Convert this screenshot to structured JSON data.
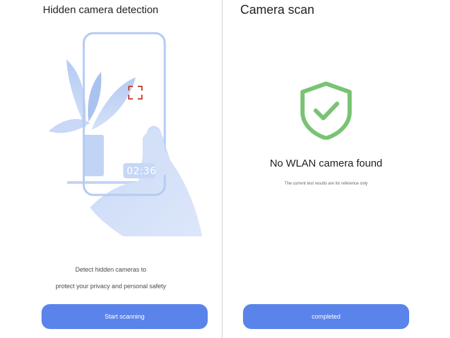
{
  "left_screen": {
    "title": "Hidden camera detection",
    "illustration": {
      "timer": "02:36"
    },
    "description_line1": "Detect hidden cameras to",
    "description_line2": "protect your privacy and personal safety",
    "start_button_label": "Start scanning"
  },
  "right_screen": {
    "title": "Camera scan",
    "result_icon": "shield-check-icon",
    "result_title": "No WLAN camera found",
    "result_note": "The current test results are for reference only",
    "completed_button_label": "completed"
  },
  "colors": {
    "accent_button": "#5b84ea",
    "shield_green": "#79c373",
    "illustration_blue": "#b7cdf3",
    "focus_frame": "#c0513f"
  }
}
